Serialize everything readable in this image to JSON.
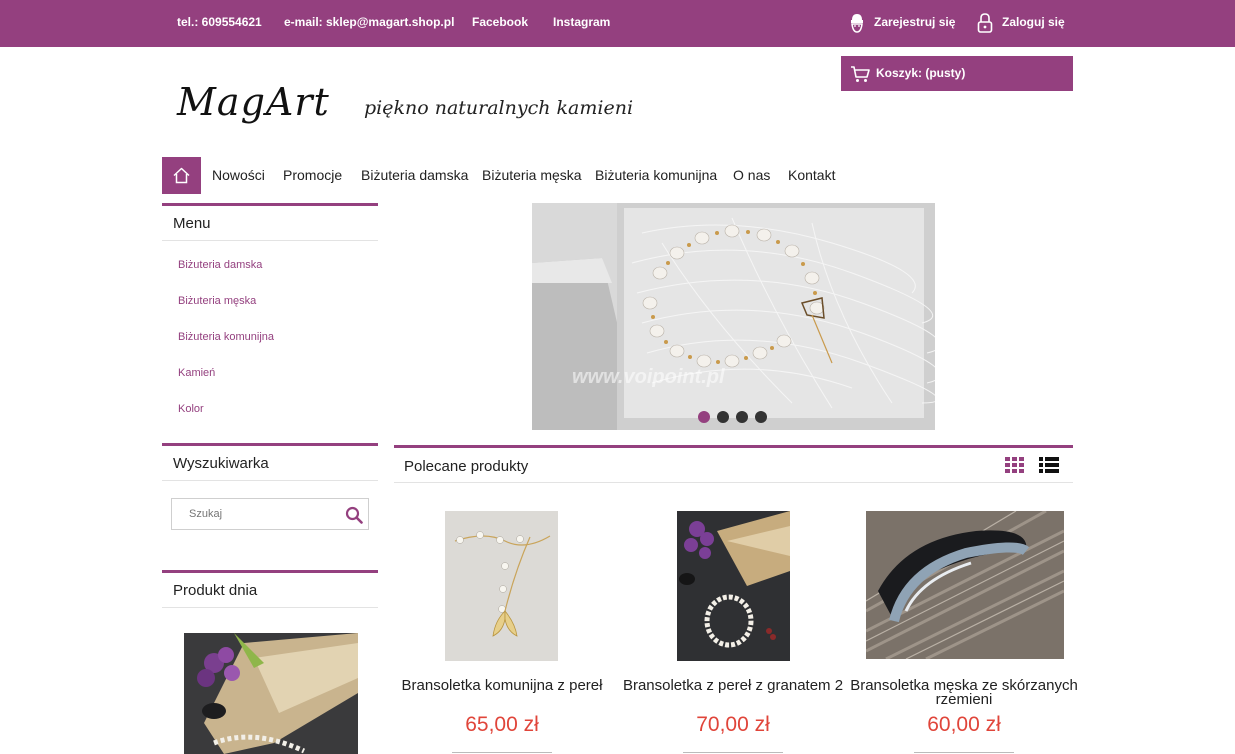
{
  "topbar": {
    "phone": "tel.: 609554621",
    "email": "e-mail: sklep@magart.shop.pl",
    "facebook": "Facebook",
    "instagram": "Instagram",
    "register": "Zarejestruj się",
    "login": "Zaloguj się"
  },
  "cart": {
    "label": "Koszyk: (pusty)"
  },
  "logo": {
    "text": "MagArt",
    "tagline": "piękno naturalnych kamieni"
  },
  "nav": {
    "items": [
      "Nowości",
      "Promocje",
      "Biżuteria damska",
      "Biżuteria męska",
      "Biżuteria komunijna",
      "O nas",
      "Kontakt"
    ]
  },
  "sidebar": {
    "menu_title": "Menu",
    "menu_items": [
      "Biżuteria damska",
      "Biżuteria męska",
      "Biżuteria komunijna",
      "Kamień",
      "Kolor"
    ],
    "search_title": "Wyszukiwarka",
    "search_placeholder": "Szukaj",
    "daily_title": "Produkt dnia"
  },
  "slider": {
    "watermark": "www.voipoint.pl",
    "slide_count": 4,
    "active_slide": 1
  },
  "featured": {
    "title": "Polecane produkty",
    "products": [
      {
        "name": "Bransoletka komunijna z pereł",
        "price": "65,00 zł"
      },
      {
        "name": "Bransoletka z pereł z granatem 2",
        "price": "70,00 zł"
      },
      {
        "name": "Bransoletka męska ze skórzanych rzemieni",
        "price": "60,00 zł"
      }
    ]
  },
  "colors": {
    "accent": "#94407f",
    "price": "#e0453a",
    "text": "#222222"
  },
  "icons": [
    "user-icon",
    "lock-icon",
    "cart-icon",
    "home-icon",
    "search-icon",
    "grid-view-icon",
    "list-view-icon"
  ]
}
